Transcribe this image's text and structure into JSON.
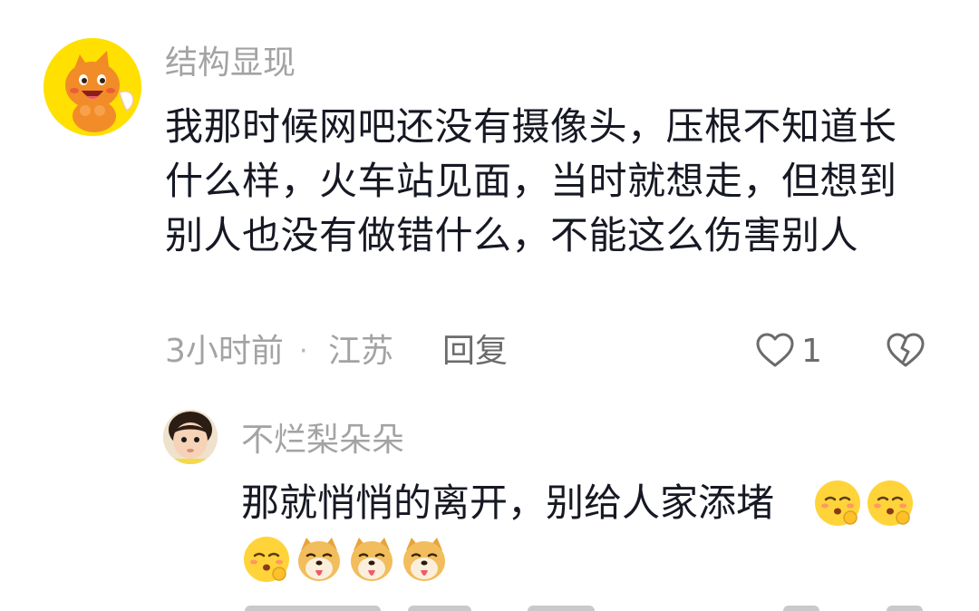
{
  "comment": {
    "username": "结构显现",
    "avatar_icon": "orange-mascot-avatar",
    "avatar_bg": "#ffe000",
    "text": "我那时候网吧还没有摄像头，压根不知道长什么样，火车站见面，当时就想走，但想到别人也没有做错什么，不能这么伤害别人",
    "time": "3小时前",
    "separator": "·",
    "location": "江苏",
    "reply_label": "回复",
    "like_icon": "heart-outline-icon",
    "like_count": "1",
    "dislike_icon": "broken-heart-icon"
  },
  "reply": {
    "username": "不烂梨朵朵",
    "avatar_icon": "child-photo-avatar",
    "text": "那就悄悄的离开，别给人家添堵",
    "emojis": [
      "shush-emoji",
      "shush-emoji",
      "shush-emoji",
      "doge-emoji",
      "doge-emoji",
      "doge-emoji"
    ]
  },
  "colors": {
    "text_primary": "#161823",
    "text_secondary": "#a3a3a3",
    "action_text": "#6b6b6b",
    "background": "#ffffff"
  }
}
